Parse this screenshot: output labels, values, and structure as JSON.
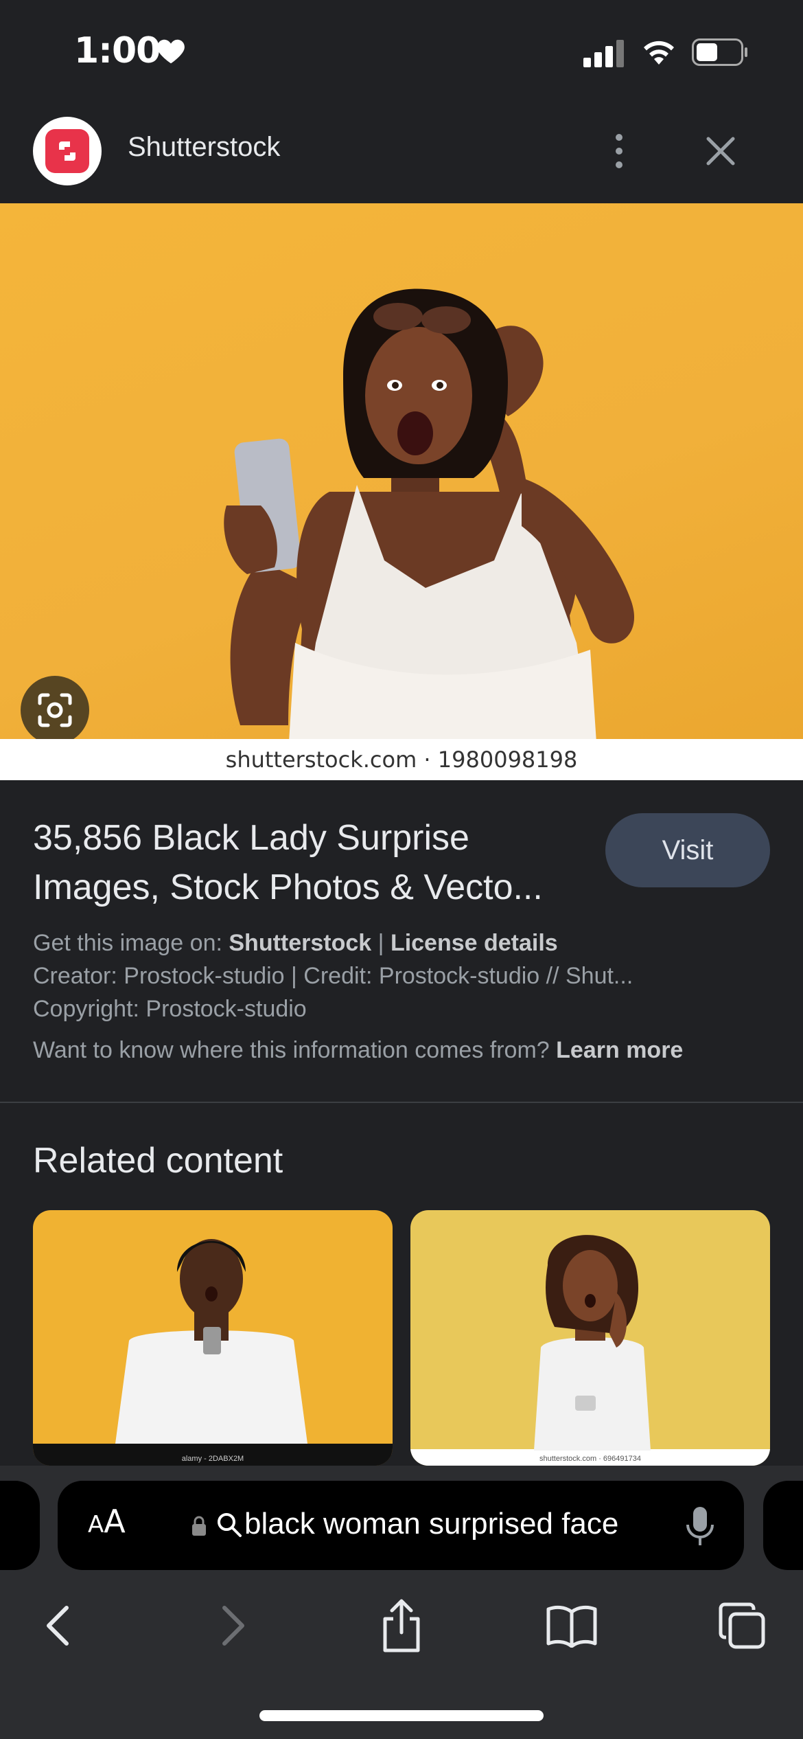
{
  "status_bar": {
    "time": "1:00"
  },
  "header": {
    "site_name": "Shutterstock"
  },
  "hero": {
    "caption": "shutterstock.com · 1980098198"
  },
  "result": {
    "title_line1": "35,856 Black Lady Surprise",
    "title_line2": "Images, Stock Photos & Vecto...",
    "visit_label": "Visit",
    "get_image_prefix": "Get this image on: ",
    "get_image_source": "Shutterstock",
    "separator": " | ",
    "license_label": "License details",
    "creator_line": "Creator: Prostock-studio | Credit: Prostock-studio // Shut...",
    "copyright_line": "Copyright: Prostock-studio",
    "info_question": "Want to know where this information comes from? ",
    "learn_more": "Learn more"
  },
  "related": {
    "title": "Related content",
    "items": [
      {
        "caption": "alamy - 2DABX2M"
      },
      {
        "caption": "shutterstock.com · 696491734"
      }
    ]
  },
  "browser": {
    "text_size_label_small": "A",
    "text_size_label_large": "A",
    "url_text": "black woman surprised face"
  },
  "colors": {
    "background": "#202124",
    "accent_logo": "#e8334a",
    "visit_button": "#3c4658",
    "hero_background": "#f4b53a"
  }
}
